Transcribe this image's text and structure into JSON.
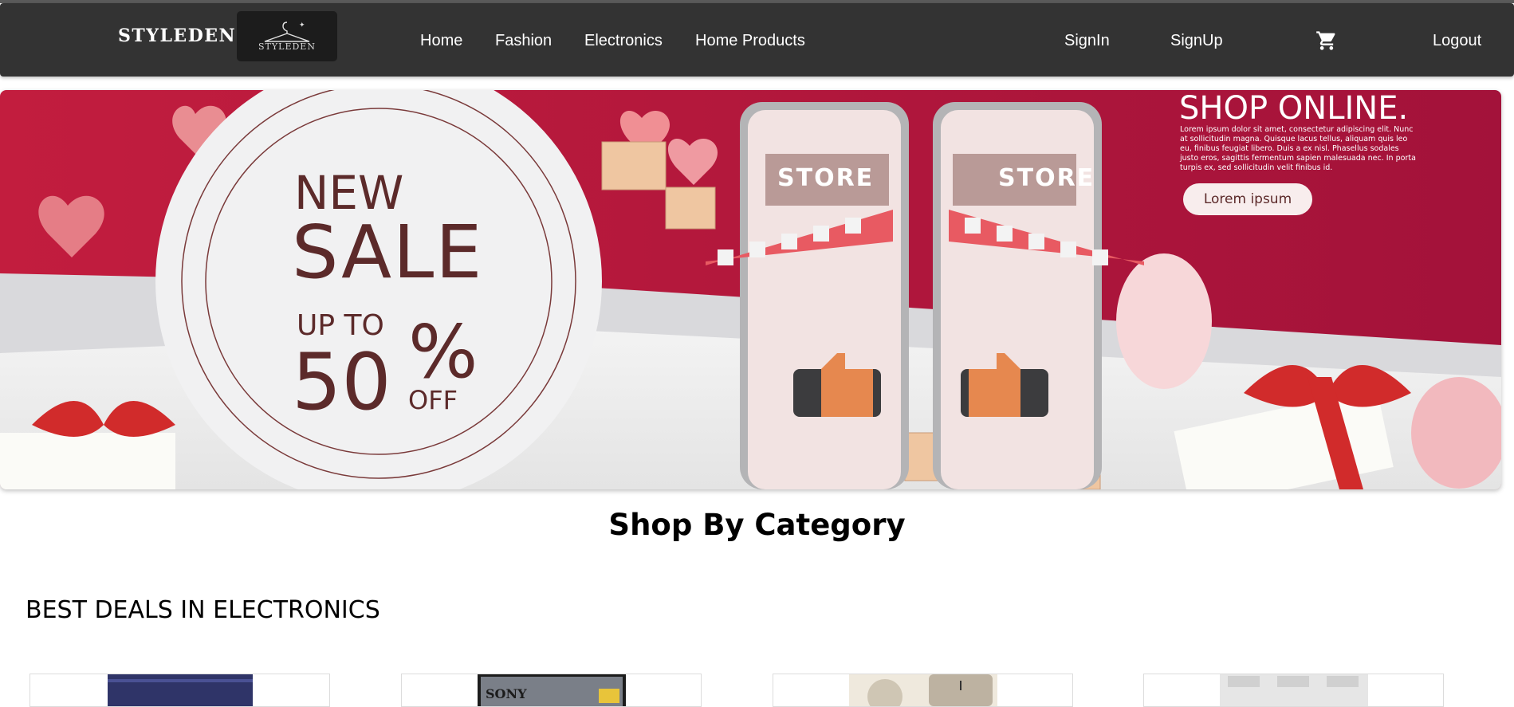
{
  "navbar": {
    "brand": "STYLEDEN",
    "logo_text": "STYLEDEN",
    "links": {
      "home": "Home",
      "fashion": "Fashion",
      "electronics": "Electronics",
      "home_products": "Home Products"
    },
    "signin": "SignIn",
    "signup": "SignUp",
    "cart_icon": "shopping-cart-icon",
    "logout": "Logout"
  },
  "banner": {
    "new": "NEW",
    "sale": "SALE",
    "up_to": "UP TO",
    "percent_value": "50",
    "percent_sign": "%",
    "off": "OFF",
    "store_left": "STORE",
    "store_right": "STORE",
    "shop_online": "SHOP ONLINE.",
    "paragraph": "Lorem ipsum dolor sit amet, consectetur adipiscing elit. Nunc at sollicitudin magna. Quisque lacus tellus, aliquam quis leo eu, finibus feugiat libero. Duis a ex nisl. Phasellus sodales justo eros, sagittis fermentum sapien malesuada nec. In porta turpis ex, sed sollicitudin velit finibus id.",
    "button": "Lorem ipsum",
    "colors": {
      "primary": "#b81a3c",
      "dark_text": "#5c2a2a"
    }
  },
  "sections": {
    "shop_by_category": "Shop By Category",
    "best_deals": "BEST DEALS IN ELECTRONICS"
  },
  "products": [
    {
      "name": "paint-bucket"
    },
    {
      "name": "sony-tv"
    },
    {
      "name": "washing-machine"
    },
    {
      "name": "refrigerator"
    }
  ]
}
